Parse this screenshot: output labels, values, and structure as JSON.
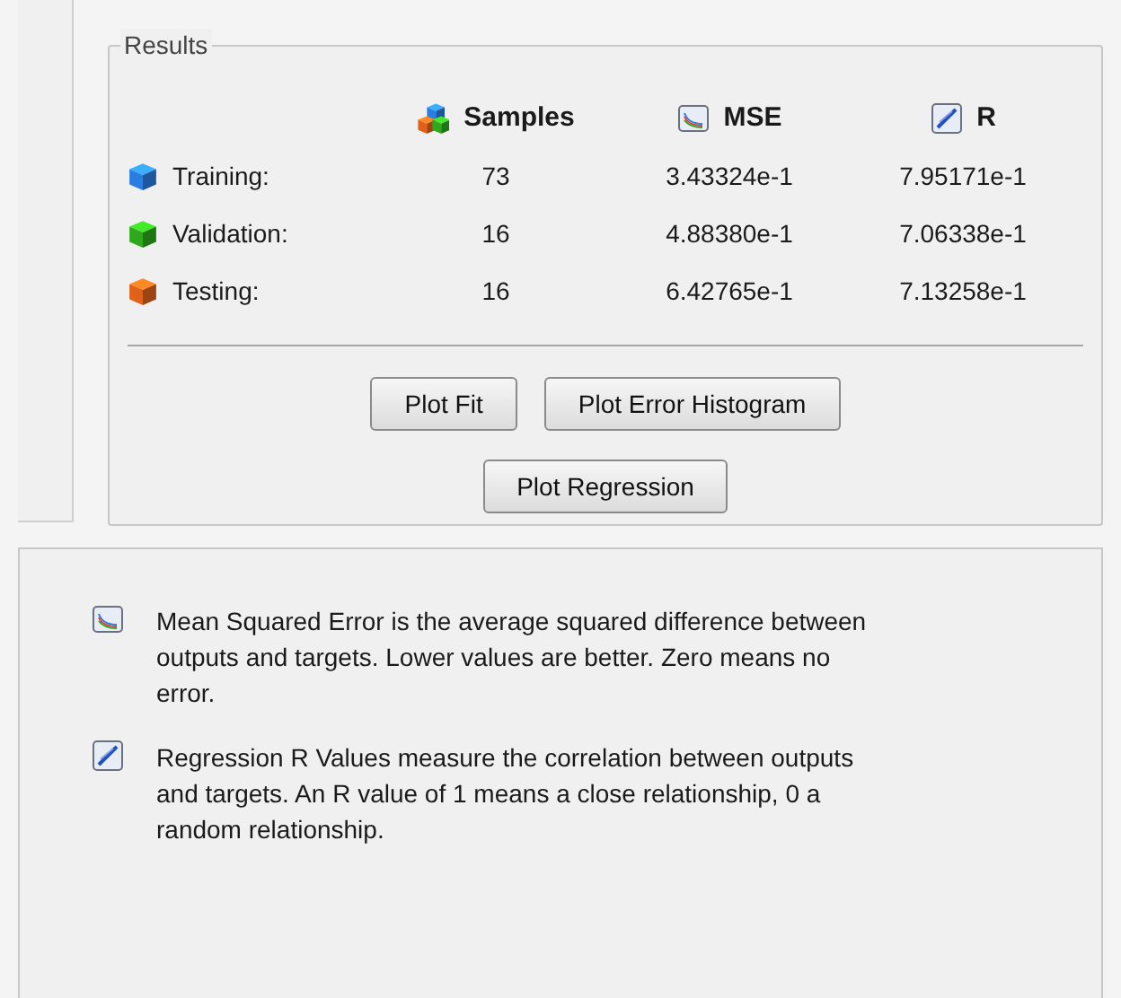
{
  "results": {
    "title": "Results",
    "columns": [
      {
        "label": "Samples",
        "kind": "samples"
      },
      {
        "label": "MSE",
        "kind": "mse"
      },
      {
        "label": "R",
        "kind": "r"
      }
    ],
    "rows": [
      {
        "label": "Training:",
        "color": "#2a7de1",
        "values": [
          "73",
          "3.43324e-1",
          "7.95171e-1"
        ]
      },
      {
        "label": "Validation:",
        "color": "#2fa81c",
        "values": [
          "16",
          "4.88380e-1",
          "7.06338e-1"
        ]
      },
      {
        "label": "Testing:",
        "color": "#e0621a",
        "values": [
          "16",
          "6.42765e-1",
          "7.13258e-1"
        ]
      }
    ],
    "buttons": [
      [
        "Plot Fit",
        "Plot Error Histogram"
      ],
      [
        "Plot Regression"
      ]
    ]
  },
  "notes": [
    {
      "kind": "mse",
      "text": "Mean Squared Error is the average squared difference between outputs and targets. Lower values are better. Zero means no error."
    },
    {
      "kind": "r",
      "text": "Regression R Values measure the correlation between outputs and targets. An R value of 1 means a close relationship, 0 a random relationship."
    }
  ]
}
